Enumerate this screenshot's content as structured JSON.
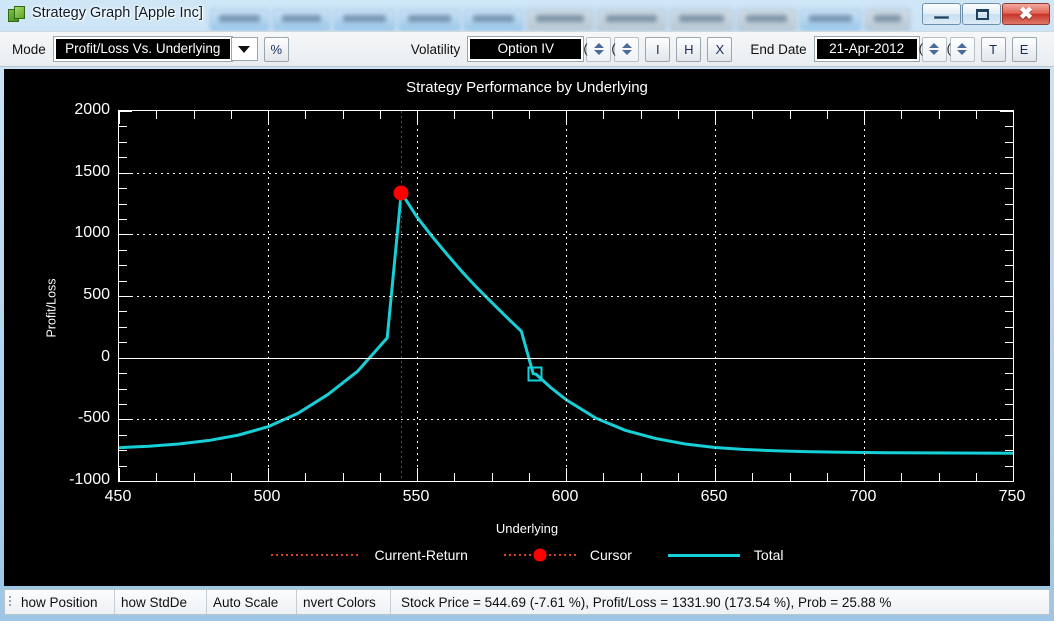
{
  "window": {
    "title": "Strategy Graph [Apple Inc]",
    "icon": "app-cube-icon",
    "buttons": {
      "minimize": "minimize-icon",
      "maximize": "maximize-icon",
      "close": "✖"
    }
  },
  "toolbar": {
    "mode_label": "Mode",
    "mode_value": "Profit/Loss Vs. Underlying",
    "percent_button": "%",
    "volatility_label": "Volatility",
    "volatility_value": "Option IV",
    "vol_buttons": [
      "I",
      "H",
      "X"
    ],
    "enddate_label": "End Date",
    "enddate_value": "21-Apr-2012",
    "date_buttons": [
      "T",
      "E"
    ]
  },
  "statusbar": {
    "toggles": [
      "how Position",
      "how StdDe",
      "Auto Scale",
      "nvert Colors"
    ],
    "info": "Stock Price = 544.69 (-7.61 %), Profit/Loss = 1331.90 (173.54 %), Prob = 25.88 %"
  },
  "chart_data": {
    "type": "line",
    "title": "Strategy Performance by Underlying",
    "xlabel": "Underlying",
    "ylabel": "Profit/Loss",
    "xlim": [
      450,
      750
    ],
    "ylim": [
      -1000,
      2000
    ],
    "xticks": [
      450,
      500,
      550,
      600,
      650,
      700,
      750
    ],
    "yticks": [
      2000,
      1500,
      1000,
      500,
      0,
      -500,
      -1000
    ],
    "grid": true,
    "legend_position": "bottom",
    "background": "#000000",
    "colors": {
      "total": "#17cfd6",
      "cursor": "#ff0000",
      "current_return": "#d4452a",
      "axis": "#ffffff"
    },
    "series": [
      {
        "name": "Total",
        "color": "#17cfd6",
        "points": [
          [
            450,
            -730
          ],
          [
            460,
            -718
          ],
          [
            470,
            -700
          ],
          [
            480,
            -672
          ],
          [
            490,
            -628
          ],
          [
            500,
            -560
          ],
          [
            510,
            -452
          ],
          [
            520,
            -300
          ],
          [
            530,
            -112
          ],
          [
            540,
            160
          ],
          [
            544.69,
            1331.9
          ],
          [
            546,
            1290
          ],
          [
            550,
            1140
          ],
          [
            555,
            985
          ],
          [
            560,
            840
          ],
          [
            565,
            700
          ],
          [
            570,
            570
          ],
          [
            575,
            450
          ],
          [
            580,
            330
          ],
          [
            585,
            215
          ],
          [
            589,
            -130
          ],
          [
            590,
            -135
          ],
          [
            595,
            -245
          ],
          [
            600,
            -340
          ],
          [
            610,
            -490
          ],
          [
            620,
            -590
          ],
          [
            630,
            -655
          ],
          [
            640,
            -700
          ],
          [
            650,
            -728
          ],
          [
            660,
            -745
          ],
          [
            670,
            -755
          ],
          [
            680,
            -762
          ],
          [
            690,
            -766
          ],
          [
            700,
            -769
          ],
          [
            710,
            -771
          ],
          [
            720,
            -772
          ],
          [
            730,
            -773
          ],
          [
            740,
            -774
          ],
          [
            750,
            -775
          ]
        ]
      }
    ],
    "markers": [
      {
        "name": "Cursor",
        "shape": "circle",
        "color": "#ff0000",
        "x": 544.69,
        "y": 1331.9
      },
      {
        "name": "Position",
        "shape": "square-hollow",
        "color": "#17cfd6",
        "x": 589.5,
        "y": -130
      }
    ],
    "vlines": [
      {
        "name": "Current-Return",
        "x": 544.69,
        "color": "#d4452a",
        "style": "dotted"
      }
    ],
    "hlines": [
      {
        "name": "zero-line",
        "y": 0,
        "color": "#ffffff",
        "style": "solid"
      }
    ],
    "legend": [
      {
        "label": "Current-Return",
        "marker": "dotted-line",
        "color": "#d4452a"
      },
      {
        "label": "Cursor",
        "marker": "dot",
        "color": "#ff0000"
      },
      {
        "label": "Total",
        "marker": "line",
        "color": "#17cfd6"
      }
    ]
  }
}
